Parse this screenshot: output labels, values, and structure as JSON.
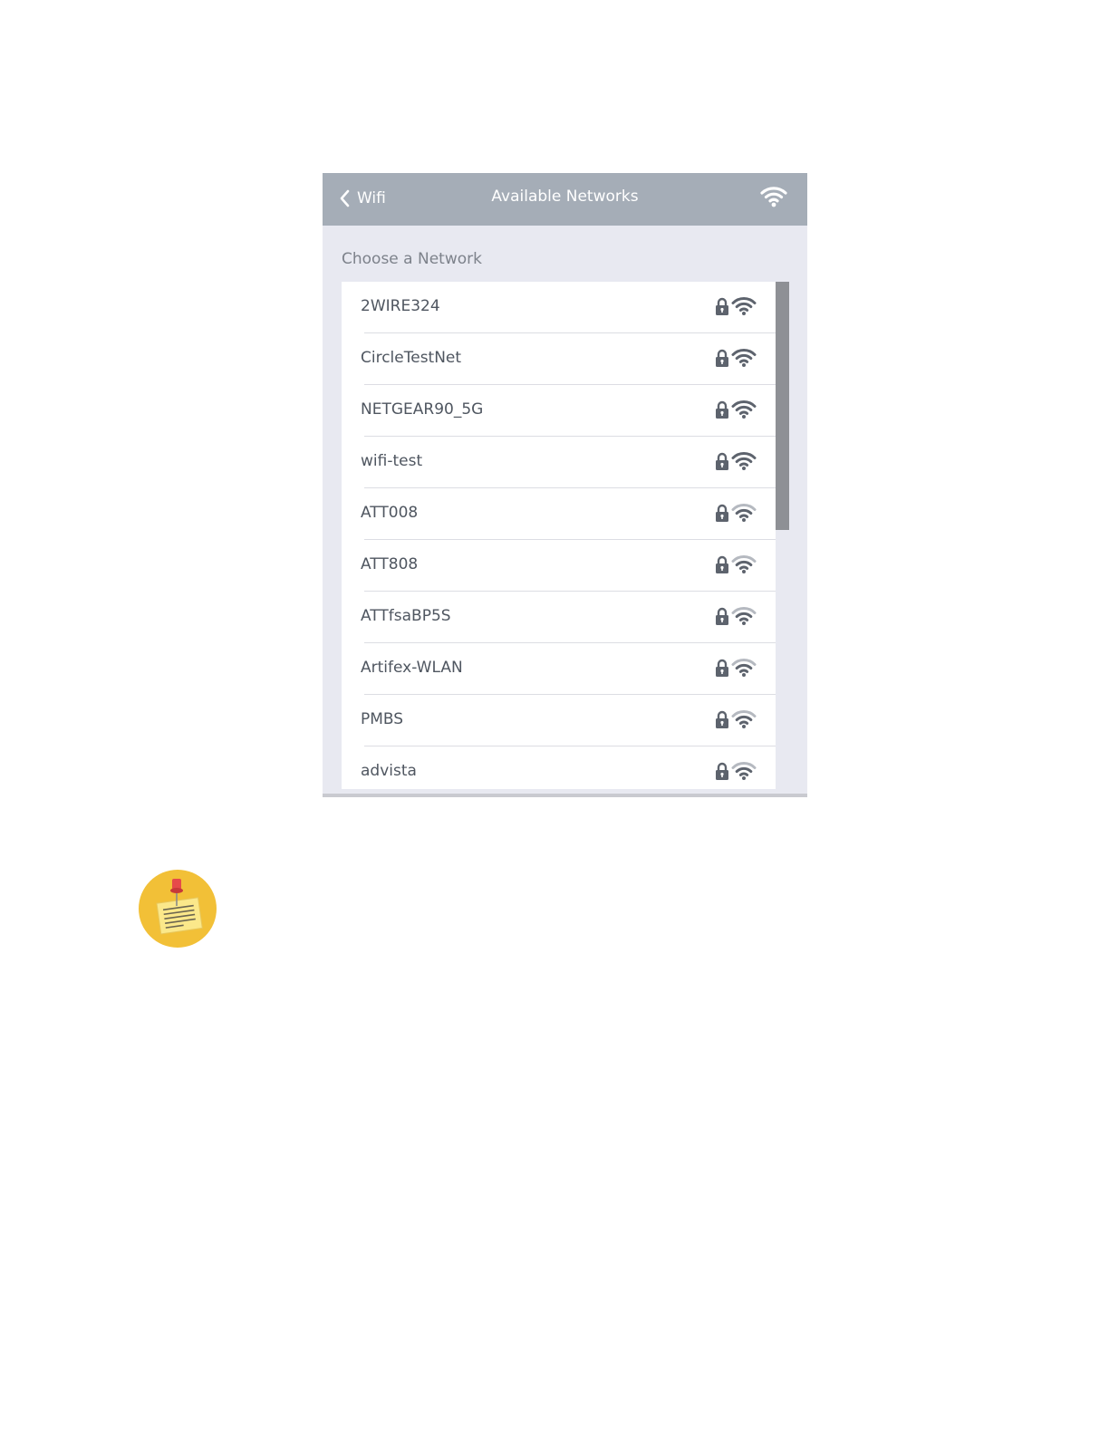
{
  "header": {
    "back_label": "Wifi",
    "title": "Available Networks",
    "status_icon": "wifi-icon"
  },
  "section_label": "Choose a Network",
  "networks": [
    {
      "name": "2WIRE324",
      "secured": true,
      "signal": "strong"
    },
    {
      "name": "CircleTestNet",
      "secured": true,
      "signal": "strong"
    },
    {
      "name": "NETGEAR90_5G",
      "secured": true,
      "signal": "strong"
    },
    {
      "name": "wifi-test",
      "secured": true,
      "signal": "strong"
    },
    {
      "name": "ATT008",
      "secured": true,
      "signal": "medium"
    },
    {
      "name": "ATT808",
      "secured": true,
      "signal": "medium"
    },
    {
      "name": "ATTfsaBP5S",
      "secured": true,
      "signal": "medium"
    },
    {
      "name": "Artifex-WLAN",
      "secured": true,
      "signal": "medium"
    },
    {
      "name": "PMBS",
      "secured": true,
      "signal": "medium"
    },
    {
      "name": "advista",
      "secured": true,
      "signal": "medium"
    }
  ],
  "colors": {
    "header_bg": "#a5adb7",
    "panel_bg": "#e8e9f1",
    "icon_dark": "#5d636d",
    "icon_light": "#b5b9c0",
    "note_circle": "#f2c037"
  },
  "note_icon": "sticky-note-icon"
}
